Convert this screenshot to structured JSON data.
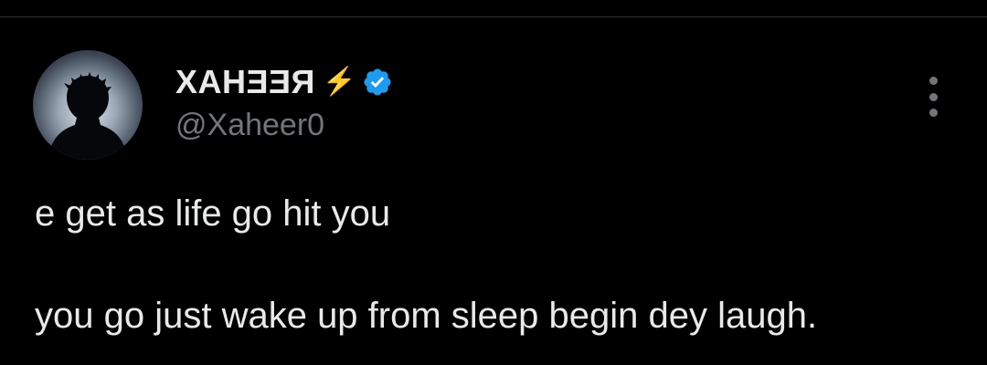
{
  "author": {
    "display_name": "XAHƎƎЯ",
    "bolt_symbol": "⚡",
    "handle": "@Xaheer0",
    "verified_icon": "verified-badge-icon",
    "verified_color": "#1d9bf0"
  },
  "more_icon": "more-options-icon",
  "tweet": {
    "line_1": "e get as life go hit you",
    "line_2": "you go just wake up from sleep begin dey laugh."
  }
}
